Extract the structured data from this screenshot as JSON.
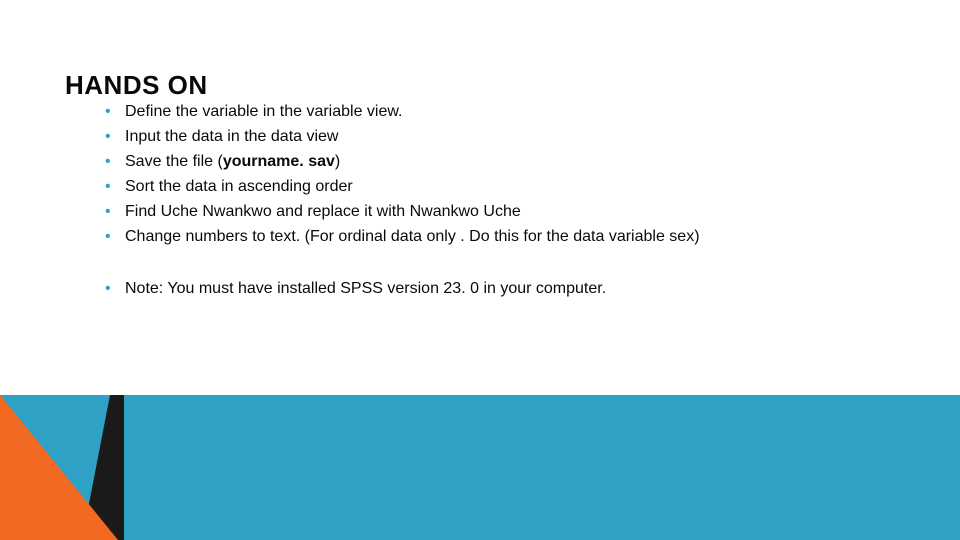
{
  "title": "HANDS ON",
  "items": [
    {
      "text": "Define  the variable  in the variable view."
    },
    {
      "prefix": "Input the data in the data view"
    },
    {
      "prefix": "Save the file (",
      "bold": "yourname. sav",
      "suffix": ")"
    },
    {
      "prefix": "Sort the data in ascending order"
    },
    {
      "prefix": "Find Uche Nwankwo and replace it with Nwankwo Uche"
    },
    {
      "prefix": "Change numbers to text. (For ordinal data only . Do this for the data variable sex)"
    }
  ],
  "note": "Note: You must have installed SPSS version 23. 0 in your computer.",
  "colors": {
    "blue": "#2ea1c4",
    "orange": "#f26a21",
    "black": "#1a1a1a"
  }
}
